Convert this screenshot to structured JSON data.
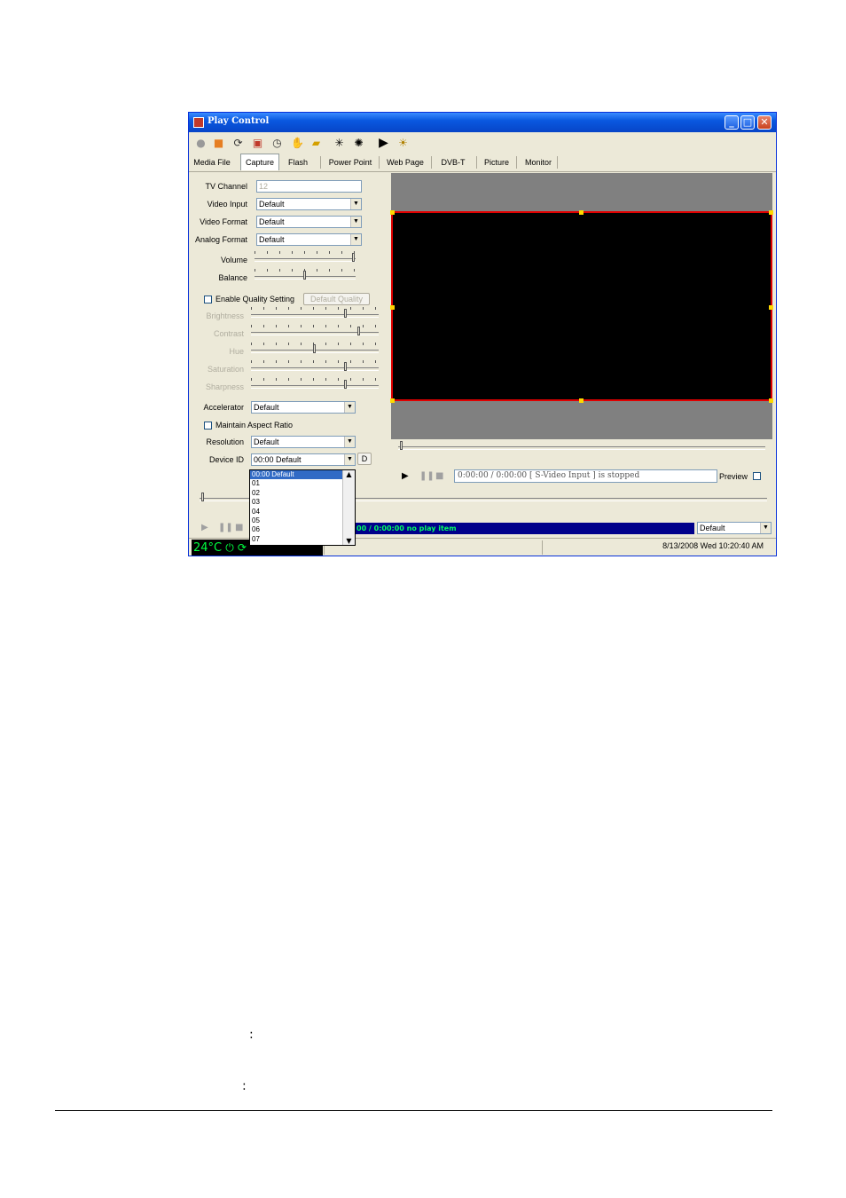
{
  "window": {
    "title": "Play Control",
    "buttons": {
      "minimize": "_",
      "maximize": "□",
      "close": "✕"
    }
  },
  "tabs": [
    "Media File",
    "Capture",
    "Flash",
    "Power Point",
    "Web Page",
    "DVB-T",
    "Picture",
    "Monitor"
  ],
  "active_tab": "Capture",
  "capture": {
    "tv_channel_label": "TV Channel",
    "tv_channel_value": "12",
    "video_input_label": "Video Input",
    "video_input_value": "Default",
    "video_format_label": "Video Format",
    "video_format_value": "Default",
    "analog_format_label": "Analog Format",
    "analog_format_value": "Default",
    "volume_label": "Volume",
    "balance_label": "Balance",
    "enable_quality_label": "Enable Quality Setting",
    "default_quality_button": "Default Quality",
    "brightness_label": "Brightness",
    "contrast_label": "Contrast",
    "hue_label": "Hue",
    "saturation_label": "Saturation",
    "sharpness_label": "Sharpness",
    "accelerator_label": "Accelerator",
    "accelerator_value": "Default",
    "maintain_aspect_label": "Maintain Aspect Ratio",
    "resolution_label": "Resolution",
    "resolution_value": "Default",
    "device_id_label": "Device ID",
    "device_id_value": "00:00 Default",
    "device_id_button": "D",
    "device_id_options": [
      "00:00 Default",
      "01",
      "02",
      "03",
      "04",
      "05",
      "06",
      "07"
    ]
  },
  "sliders": {
    "volume": 1.0,
    "balance": 0.5,
    "brightness": 0.75,
    "contrast": 0.86,
    "hue": 0.5,
    "saturation": 0.75,
    "sharpness": 0.75
  },
  "preview": {
    "status_text": "0:00:00 / 0:00:00  [ S-Video Input ]  is stopped",
    "preview_label": "Preview"
  },
  "playlist": {
    "status_text": "00 / 0:00:00  no play item",
    "select_value": "Default"
  },
  "statusbar": {
    "temperature": "24°C",
    "datetime": "8/13/2008 Wed 10:20:40 AM"
  },
  "page": {
    "colon1": ":",
    "colon2": ":"
  }
}
